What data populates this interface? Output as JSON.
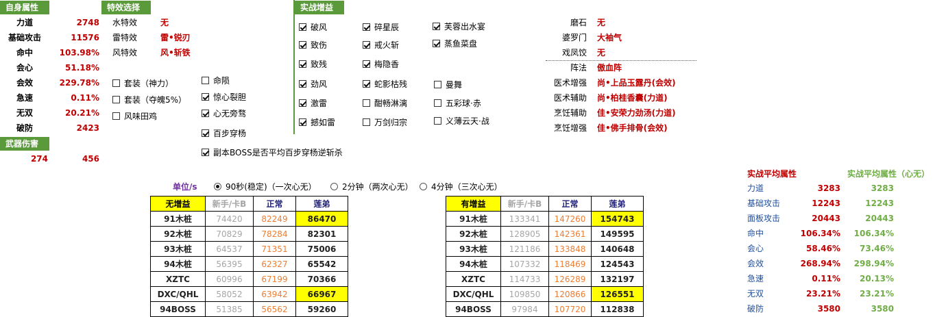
{
  "self_attr": {
    "header": "自身属性",
    "rows": [
      {
        "label": "力道",
        "value": "2748"
      },
      {
        "label": "基础攻击",
        "value": "11576"
      },
      {
        "label": "命中",
        "value": "103.98%"
      },
      {
        "label": "会心",
        "value": "51.18%"
      },
      {
        "label": "会效",
        "value": "229.78%"
      },
      {
        "label": "急速",
        "value": "0.11%"
      },
      {
        "label": "无双",
        "value": "20.21%"
      },
      {
        "label": "破防",
        "value": "2423"
      }
    ]
  },
  "weapon": {
    "header": "武器伤害",
    "min": "274",
    "max": "456"
  },
  "effects": {
    "header": "特效选择",
    "rows": [
      {
        "label": "水特效",
        "value": "无"
      },
      {
        "label": "雷特效",
        "value": "雷•锐刃"
      },
      {
        "label": "风特效",
        "value": "风•斩铁"
      }
    ]
  },
  "left_checks": [
    {
      "label": "套装（神力）",
      "checked": false
    },
    {
      "label": "套装（夺魄5%）",
      "checked": false
    },
    {
      "label": "风味田鸡",
      "checked": false
    }
  ],
  "mid_checks": [
    {
      "label": "命陨",
      "checked": false
    },
    {
      "label": "惊心裂胆",
      "checked": true
    },
    {
      "label": "心无旁骛",
      "checked": true
    },
    {
      "label": "百步穿杨",
      "checked": true
    },
    {
      "label": "副本BOSS是否平均百步穿杨逆斩杀",
      "checked": true
    }
  ],
  "buffs": {
    "header": "实战增益",
    "col1": [
      {
        "label": "破风",
        "checked": true
      },
      {
        "label": "致伤",
        "checked": true
      },
      {
        "label": "致残",
        "checked": true
      },
      {
        "label": "劲风",
        "checked": true
      },
      {
        "label": "激雷",
        "checked": true
      },
      {
        "label": "撼如雷",
        "checked": true
      }
    ],
    "col2": [
      {
        "label": "碎星辰",
        "checked": true
      },
      {
        "label": "戒火斩",
        "checked": true
      },
      {
        "label": "梅隐香",
        "checked": true
      },
      {
        "label": "蛇影枯残",
        "checked": true
      },
      {
        "label": "酣畅淋漓",
        "checked": false
      },
      {
        "label": "万剑归宗",
        "checked": false
      }
    ],
    "col3a": [
      {
        "label": "芙蓉出水宴",
        "checked": true
      },
      {
        "label": "蒸鱼菜盘",
        "checked": true
      }
    ],
    "col3b": [
      {
        "label": "曼舞",
        "checked": false
      },
      {
        "label": "五彩球·赤",
        "checked": false
      },
      {
        "label": "义薄云天·战",
        "checked": false
      }
    ]
  },
  "right_info": [
    {
      "label": "磨石",
      "value": "无"
    },
    {
      "label": "婆罗门",
      "value": "大袖气"
    },
    {
      "label": "戏凤饺",
      "value": "无"
    },
    {
      "label": "阵法",
      "value": "傲血阵"
    },
    {
      "label": "医术增强",
      "value": "尚•上品玉露丹(会效)"
    },
    {
      "label": "医术辅助",
      "value": "尚•柏桂香囊(力道)"
    },
    {
      "label": "烹饪辅助",
      "value": "佳•安荣力劲汤(力道)"
    },
    {
      "label": "烹饪增强",
      "value": "佳•佛手排骨(会效)"
    }
  ],
  "unit": {
    "label": "单位/s",
    "options": [
      {
        "label": "90秒(稳定)（一次心无）",
        "selected": true
      },
      {
        "label": "2分钟（两次心无）",
        "selected": false
      },
      {
        "label": "4分钟（三次心无）",
        "selected": false
      }
    ]
  },
  "table_no_buff": {
    "headers": [
      "无增益",
      "新手/卡B",
      "正常",
      "莲弟"
    ],
    "rows": [
      [
        "91木桩",
        "74420",
        "82249",
        "86470"
      ],
      [
        "92木桩",
        "70829",
        "78284",
        "82301"
      ],
      [
        "93木桩",
        "64537",
        "71351",
        "75006"
      ],
      [
        "94木桩",
        "56395",
        "62327",
        "65542"
      ],
      [
        "XZTC",
        "60996",
        "67199",
        "70366"
      ],
      [
        "DXC/QHL",
        "58052",
        "63942",
        "66967"
      ],
      [
        "94BOSS",
        "51385",
        "56562",
        "59260"
      ]
    ],
    "highlight": [
      [
        0,
        3
      ],
      [
        5,
        3
      ]
    ]
  },
  "table_buff": {
    "headers": [
      "有增益",
      "新手/卡B",
      "正常",
      "莲弟"
    ],
    "rows": [
      [
        "91木桩",
        "133341",
        "147260",
        "154743"
      ],
      [
        "92木桩",
        "128905",
        "142361",
        "149595"
      ],
      [
        "93木桩",
        "121186",
        "133848",
        "140648"
      ],
      [
        "94木桩",
        "107332",
        "118469",
        "124543"
      ],
      [
        "XZTC",
        "114733",
        "126289",
        "132197"
      ],
      [
        "DXC/QHL",
        "109850",
        "120866",
        "126551"
      ],
      [
        "94BOSS",
        "97984",
        "107720",
        "112838"
      ]
    ],
    "highlight": [
      [
        0,
        3
      ],
      [
        5,
        3
      ]
    ]
  },
  "combat_stats": {
    "header1": "实战平均属性",
    "header2": "实战平均属性（心无）",
    "rows": [
      {
        "label": "力道",
        "v1": "3283",
        "v2": "3283"
      },
      {
        "label": "基础攻击",
        "v1": "12243",
        "v2": "12243"
      },
      {
        "label": "面板攻击",
        "v1": "20443",
        "v2": "20443"
      },
      {
        "label": "命中",
        "v1": "106.34%",
        "v2": "106.34%"
      },
      {
        "label": "会心",
        "v1": "58.46%",
        "v2": "73.46%"
      },
      {
        "label": "会效",
        "v1": "268.94%",
        "v2": "298.94%"
      },
      {
        "label": "急速",
        "v1": "0.11%",
        "v2": "20.13%"
      },
      {
        "label": "无双",
        "v1": "23.21%",
        "v2": "23.21%"
      },
      {
        "label": "破防",
        "v1": "3580",
        "v2": "3580"
      }
    ]
  },
  "colors": {
    "header_green": "#5b9a3b",
    "value_red": "#c00000",
    "highlight": "#ffff00",
    "stat_blue": "#1f4e9c",
    "stat_green": "#70ad47",
    "orange": "#ed7d31"
  }
}
